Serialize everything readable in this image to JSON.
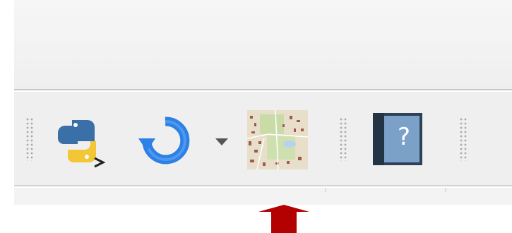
{
  "toolbar": {
    "icons": [
      "python-console-icon",
      "refresh-icon",
      "chevron-down-icon",
      "map-tile-icon",
      "help-book-icon"
    ],
    "help_glyph": "?"
  },
  "colors": {
    "python_blue": "#3a6fa8",
    "python_yellow": "#f2c634",
    "refresh_blue": "#2d80e6",
    "help_book": "#2e4257",
    "help_page": "#7ba1c9",
    "arrow_red": "#b30000"
  }
}
